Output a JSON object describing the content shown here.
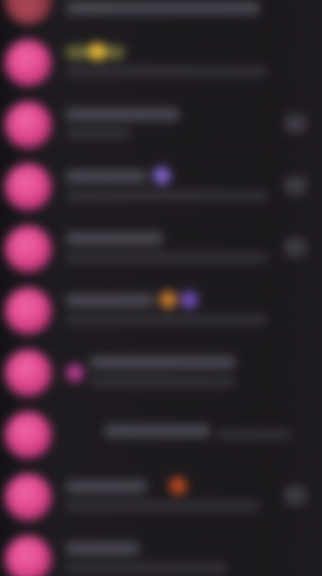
{
  "chats": [
    {
      "title": "",
      "subtitle": "",
      "meta": "",
      "partial": true,
      "emoji": "none"
    },
    {
      "title": "",
      "subtitle": "",
      "meta": "",
      "emoji": "yellow",
      "emoji_color": "#e6b73a"
    },
    {
      "title": "",
      "subtitle": "",
      "meta": "",
      "emoji": "none"
    },
    {
      "title": "",
      "subtitle": "",
      "meta": "",
      "emoji": "purple",
      "emoji_color": "#7e63c9"
    },
    {
      "title": "",
      "subtitle": "",
      "meta": "",
      "emoji": "none"
    },
    {
      "title": "",
      "subtitle": "",
      "meta": "",
      "emoji": "orange-purple",
      "emoji_color": "#c47a2d"
    },
    {
      "title": "",
      "subtitle": "",
      "meta": "",
      "emoji": "pink",
      "emoji_color": "#b23c8c"
    },
    {
      "title": "",
      "subtitle": "",
      "meta": "",
      "emoji": "none"
    },
    {
      "title": "",
      "subtitle": "",
      "meta": "",
      "emoji": "orange",
      "emoji_color": "#b8471e"
    },
    {
      "title": "",
      "subtitle": "",
      "meta": "",
      "emoji": "none"
    }
  ],
  "colors": {
    "background": "#1b181c",
    "avatar": "#e0478f"
  }
}
